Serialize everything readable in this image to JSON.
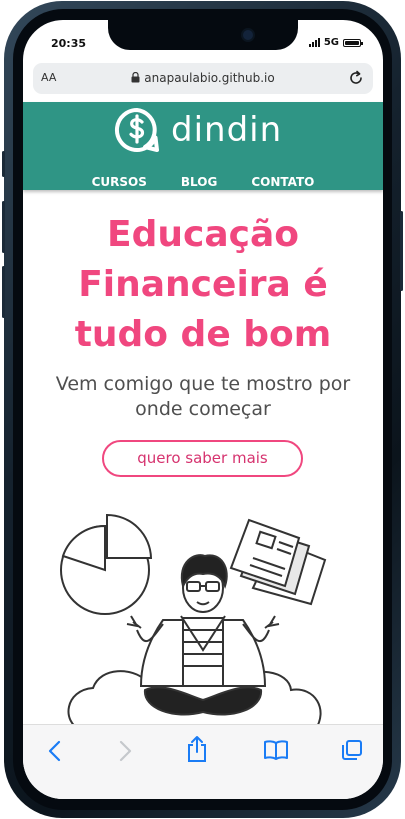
{
  "status_bar": {
    "time": "20:35",
    "network": "5G"
  },
  "browser": {
    "text_size_label": "AA",
    "url": "anapaulabio.github.io"
  },
  "site": {
    "logo_text": "dindin",
    "nav": [
      {
        "label": "CURSOS"
      },
      {
        "label": "BLOG"
      },
      {
        "label": "CONTATO"
      }
    ]
  },
  "hero": {
    "title_lines": [
      "Educação",
      "Financeira é",
      "tudo de bom"
    ],
    "subtitle_lines": [
      "Vem comigo que te mostro por",
      "onde começar"
    ],
    "cta_label": "quero saber mais"
  },
  "colors": {
    "brand_teal": "#2f9585",
    "accent_pink": "#f0477f",
    "ios_blue": "#1a7cf5"
  },
  "toolbar_icons": [
    "back-icon",
    "forward-icon",
    "share-icon",
    "bookmarks-icon",
    "tabs-icon"
  ]
}
